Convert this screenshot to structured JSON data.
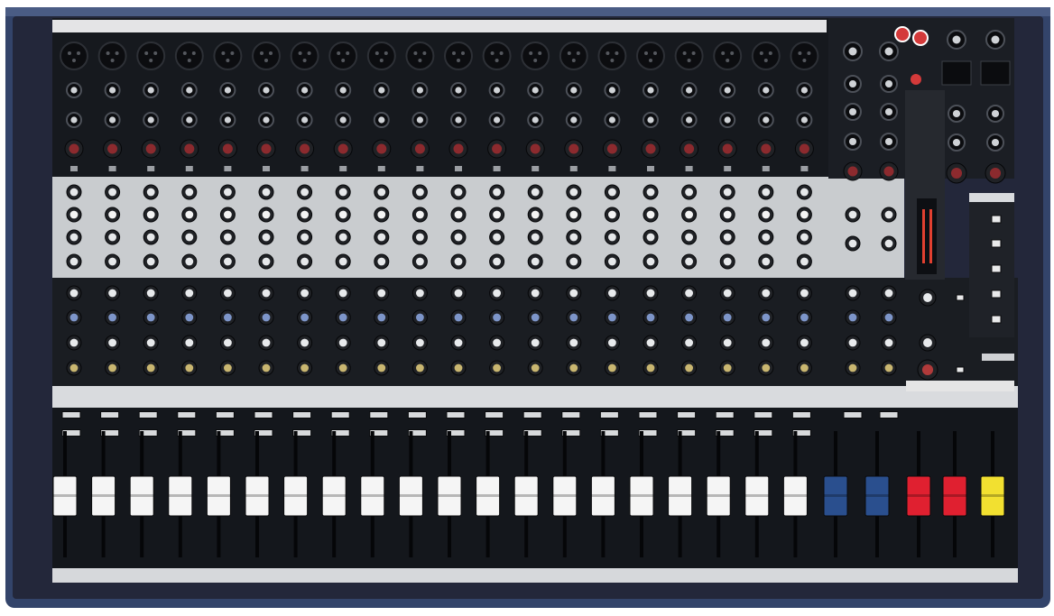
{
  "mixer": {
    "mono_channel_count": 20,
    "stereo_channel_count": 2,
    "colors": {
      "chassis": "#33446a",
      "panel_dark": "#16191e",
      "eq_band": "#c9cccf",
      "red_cap": "#8c2a2e",
      "blue_cap": "#7d95c9",
      "yellow_cap": "#c9b670",
      "fader_white": "#f5f5f5",
      "fader_blue": "#2a4f8e",
      "fader_red": "#e02030",
      "fader_yellow": "#f2e030"
    },
    "master_fader_colors": [
      "blue",
      "blue",
      "red",
      "red",
      "yellow"
    ]
  }
}
